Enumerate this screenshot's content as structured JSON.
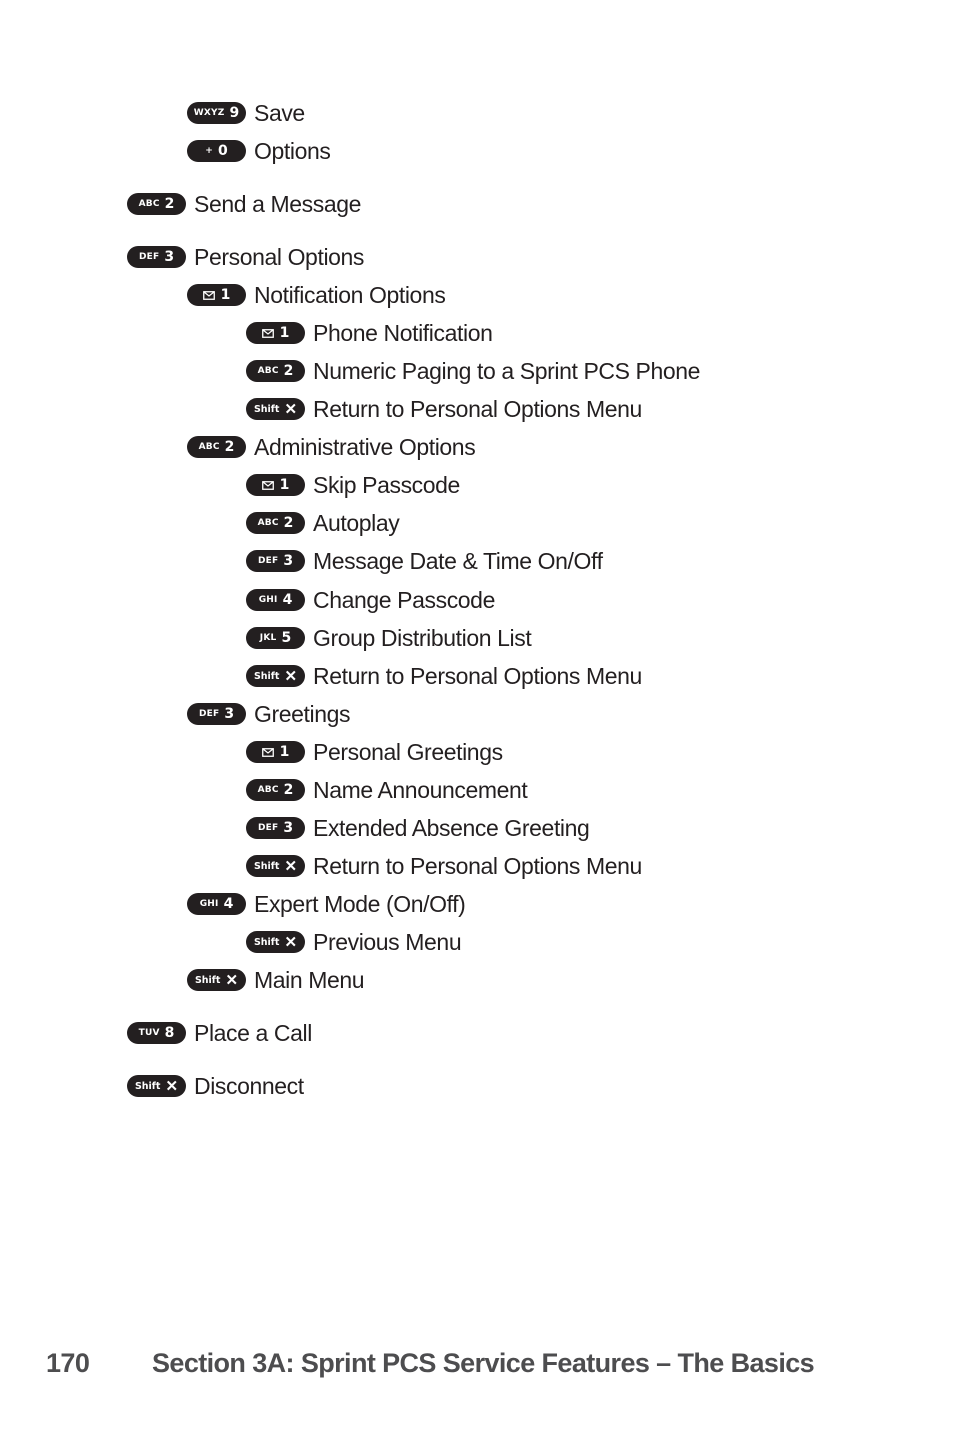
{
  "menu": [
    {
      "letters": "WXYZ",
      "key": "9",
      "icon": "",
      "label": "Save",
      "level": 1
    },
    {
      "letters": "+",
      "key": "0",
      "icon": "",
      "label": "Options",
      "level": 1
    },
    {
      "letters": "ABC",
      "key": "2",
      "icon": "",
      "label": "Send a Message",
      "level": 0
    },
    {
      "letters": "DEF",
      "key": "3",
      "icon": "",
      "label": "Personal Options",
      "level": 0
    },
    {
      "letters": "",
      "key": "1",
      "icon": "envelope-icon",
      "label": "Notification Options",
      "level": 1
    },
    {
      "letters": "",
      "key": "1",
      "icon": "envelope-icon",
      "label": "Phone Notification",
      "level": 2
    },
    {
      "letters": "ABC",
      "key": "2",
      "icon": "",
      "label": "Numeric Paging to a Sprint PCS Phone",
      "level": 2
    },
    {
      "letters": "Shift",
      "key": "✕",
      "icon": "shift-x-icon",
      "label": "Return to Personal Options Menu",
      "level": 2
    },
    {
      "letters": "ABC",
      "key": "2",
      "icon": "",
      "label": "Administrative Options",
      "level": 1
    },
    {
      "letters": "",
      "key": "1",
      "icon": "envelope-icon",
      "label": "Skip Passcode",
      "level": 2
    },
    {
      "letters": "ABC",
      "key": "2",
      "icon": "",
      "label": "Autoplay",
      "level": 2
    },
    {
      "letters": "DEF",
      "key": "3",
      "icon": "",
      "label": "Message Date & Time On/Off",
      "level": 2
    },
    {
      "letters": "GHI",
      "key": "4",
      "icon": "",
      "label": "Change Passcode",
      "level": 2
    },
    {
      "letters": "JKL",
      "key": "5",
      "icon": "",
      "label": "Group Distribution List",
      "level": 2
    },
    {
      "letters": "Shift",
      "key": "✕",
      "icon": "shift-x-icon",
      "label": "Return to Personal Options Menu",
      "level": 2
    },
    {
      "letters": "DEF",
      "key": "3",
      "icon": "",
      "label": "Greetings",
      "level": 1
    },
    {
      "letters": "",
      "key": "1",
      "icon": "envelope-icon",
      "label": "Personal Greetings",
      "level": 2
    },
    {
      "letters": "ABC",
      "key": "2",
      "icon": "",
      "label": "Name Announcement",
      "level": 2
    },
    {
      "letters": "DEF",
      "key": "3",
      "icon": "",
      "label": "Extended Absence Greeting",
      "level": 2
    },
    {
      "letters": "Shift",
      "key": "✕",
      "icon": "shift-x-icon",
      "label": "Return to Personal Options Menu",
      "level": 2
    },
    {
      "letters": "GHI",
      "key": "4",
      "icon": "",
      "label": "Expert Mode (On/Off)",
      "level": 1
    },
    {
      "letters": "Shift",
      "key": "✕",
      "icon": "shift-x-icon",
      "label": "Previous Menu",
      "level": 2
    },
    {
      "letters": "Shift",
      "key": "✕",
      "icon": "shift-x-icon",
      "label": "Main Menu",
      "level": 1
    },
    {
      "letters": "TUV",
      "key": "8",
      "icon": "",
      "label": "Place a Call",
      "level": 0
    },
    {
      "letters": "Shift",
      "key": "✕",
      "icon": "shift-x-icon",
      "label": "Disconnect",
      "level": 0
    }
  ],
  "footer": {
    "page_number": "170",
    "section_title": "Section 3A: Sprint PCS Service Features – The Basics"
  }
}
